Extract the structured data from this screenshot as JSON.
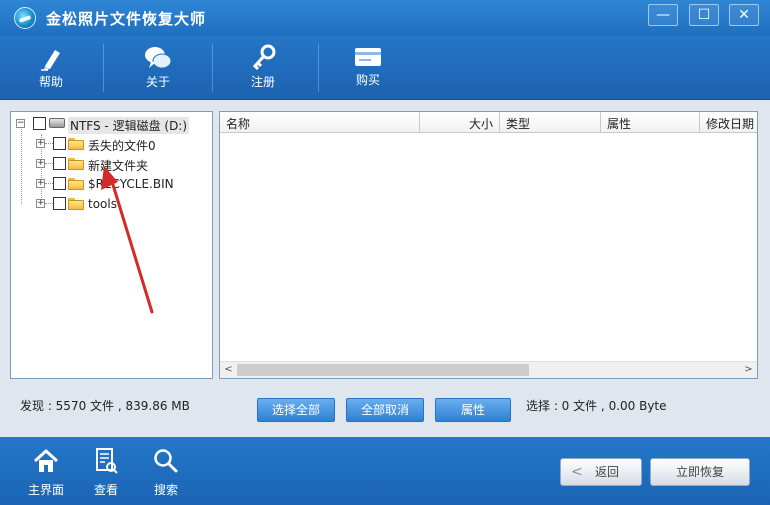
{
  "window": {
    "title": "金松照片文件恢复大师",
    "controls": {
      "minimize": "—",
      "maximize": "☐",
      "close": "✕"
    }
  },
  "toolbar": {
    "items": [
      {
        "label": "帮助",
        "icon": "pen-icon"
      },
      {
        "label": "关于",
        "icon": "chat-bubbles-icon"
      },
      {
        "label": "注册",
        "icon": "key-icon"
      },
      {
        "label": "购买",
        "icon": "card-icon"
      }
    ]
  },
  "tree": {
    "root": {
      "label": "NTFS - 逻辑磁盘 (D:)",
      "expander": "−"
    },
    "children": [
      {
        "label": "丢失的文件0",
        "expander": "+"
      },
      {
        "label": "新建文件夹",
        "expander": "+"
      },
      {
        "label": "$RECYCLE.BIN",
        "expander": "+"
      },
      {
        "label": "tools",
        "expander": "+"
      }
    ]
  },
  "file_list": {
    "columns": [
      "名称",
      "大小",
      "类型",
      "属性",
      "修改日期"
    ],
    "rows": [],
    "scroll": {
      "left": "<",
      "right": ">"
    }
  },
  "status": {
    "found": "发现 : 5570 文件 , 839.86 MB",
    "selected": "选择 : 0 文件 , 0.00 Byte"
  },
  "actions": {
    "select_all": "选择全部",
    "deselect_all": "全部取消",
    "properties": "属性"
  },
  "bottom_nav": {
    "items": [
      {
        "label": "主界面",
        "icon": "home-icon"
      },
      {
        "label": "查看",
        "icon": "view-document-icon"
      },
      {
        "label": "搜索",
        "icon": "search-icon"
      }
    ],
    "back": {
      "chevron": "<",
      "label": "返回"
    },
    "recover_now": "立即恢复"
  },
  "colors": {
    "titlebar": "#2f86d4",
    "toolbar": "#1c63b1",
    "action_button": "#2f80d3",
    "annotation_arrow": "#d42a2a"
  }
}
